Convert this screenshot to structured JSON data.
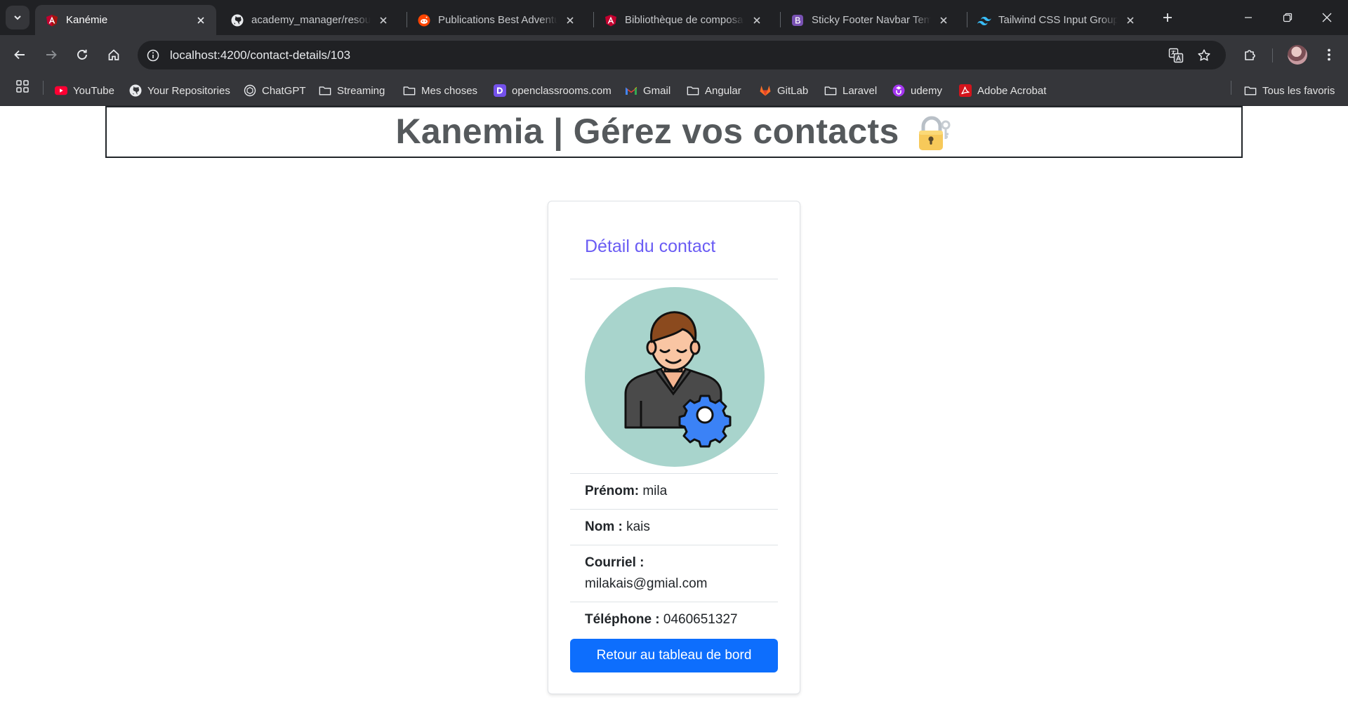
{
  "browser": {
    "tabs": [
      {
        "title": "Kanémie",
        "icon": "angular-icon",
        "active": true
      },
      {
        "title": "academy_manager/resources",
        "icon": "github-icon",
        "active": false
      },
      {
        "title": "Publications Best Adventures",
        "icon": "reddit-icon",
        "active": false
      },
      {
        "title": "Bibliothèque de composants",
        "icon": "angular-icon",
        "active": false
      },
      {
        "title": "Sticky Footer Navbar Template",
        "icon": "bootstrap-icon",
        "active": false
      },
      {
        "title": "Tailwind CSS Input Groups",
        "icon": "tailwind-icon",
        "active": false
      }
    ],
    "url": "localhost:4200/contact-details/103",
    "bookmarks": [
      {
        "label": "YouTube",
        "icon": "youtube-icon"
      },
      {
        "label": "Your Repositories",
        "icon": "github-icon"
      },
      {
        "label": "ChatGPT",
        "icon": "chatgpt-icon"
      },
      {
        "label": "Streaming",
        "icon": "folder-icon"
      },
      {
        "label": "Mes choses",
        "icon": "folder-icon"
      },
      {
        "label": "openclassrooms.com",
        "icon": "openclassrooms-icon"
      },
      {
        "label": "Gmail",
        "icon": "gmail-icon"
      },
      {
        "label": "Angular",
        "icon": "folder-icon"
      },
      {
        "label": "GitLab",
        "icon": "gitlab-icon"
      },
      {
        "label": "Laravel",
        "icon": "folder-icon"
      },
      {
        "label": "udemy",
        "icon": "udemy-icon"
      },
      {
        "label": "Adobe Acrobat",
        "icon": "acrobat-icon"
      }
    ],
    "all_bookmarks": "Tous les favoris"
  },
  "app": {
    "title": "Kanemia | Gérez vos contacts",
    "title_emoji": "lock-with-key-icon"
  },
  "card": {
    "title": "Détail du contact",
    "avatar_icon": "user-settings-icon",
    "fields": {
      "first_name_label": "Prénom:",
      "first_name": "mila",
      "last_name_label": "Nom :",
      "last_name": "kais",
      "email_label": "Courriel :",
      "email": "milakais@gmial.com",
      "phone_label": "Téléphone :",
      "phone": "0460651327"
    },
    "back_button": "Retour au tableau de bord"
  },
  "colors": {
    "chrome_dark": "#202124",
    "chrome_toolbar": "#35363a",
    "card_title": "#6a5cf4",
    "avatar_bg": "#a8d4cc",
    "primary_button": "#0d6efd",
    "header_text": "#55595c"
  }
}
